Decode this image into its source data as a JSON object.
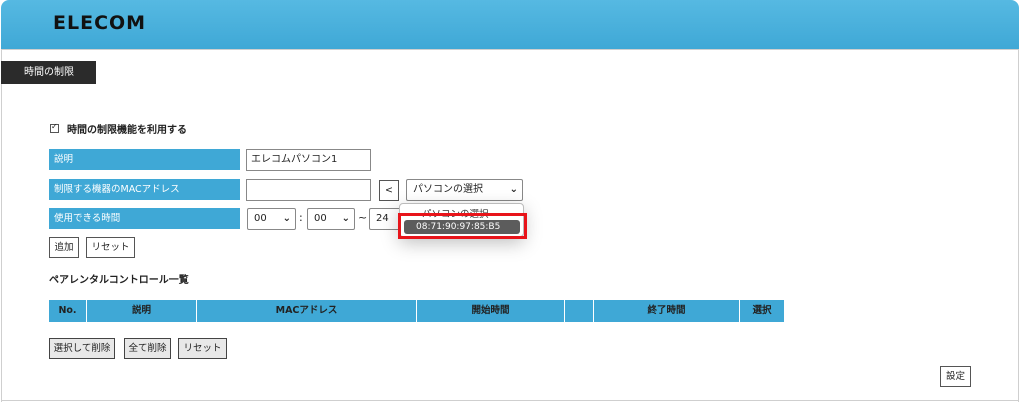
{
  "header": {
    "logo": "ELECOM"
  },
  "section_tab": "時間の制限",
  "enable": {
    "label": "時間の制限機能を利用する",
    "checked": true
  },
  "form": {
    "description_label": "説明",
    "description_value": "エレコムパソコン1",
    "mac_label": "制限する機器のMACアドレス",
    "mac_value": "",
    "arrow_button": "<",
    "pc_select": "パソコンの選択",
    "time_label": "使用できる時間",
    "start_hour": "00",
    "start_min": "00",
    "time_separator": ":",
    "range_separator": "~",
    "end_hour": "24",
    "add_button": "追加",
    "reset_button": "リセット"
  },
  "dropdown": {
    "options": [
      "パソコンの選択",
      "08:71:90:97:85:B5"
    ],
    "highlighted": "08:71:90:97:85:B5"
  },
  "list": {
    "title": "ペアレンタルコントロール一覧",
    "columns": [
      "No.",
      "説明",
      "MACアドレス",
      "開始時間",
      "",
      "終了時間",
      "選択"
    ]
  },
  "actions": {
    "delete_selected": "選択して削除",
    "delete_all": "全て削除",
    "reset": "リセット",
    "apply": "設定"
  },
  "colors": {
    "header": "#3fa8d6",
    "label_bg": "#3fa8d6",
    "tab_bg": "#2b2b2b",
    "highlight": "#e8141a"
  }
}
